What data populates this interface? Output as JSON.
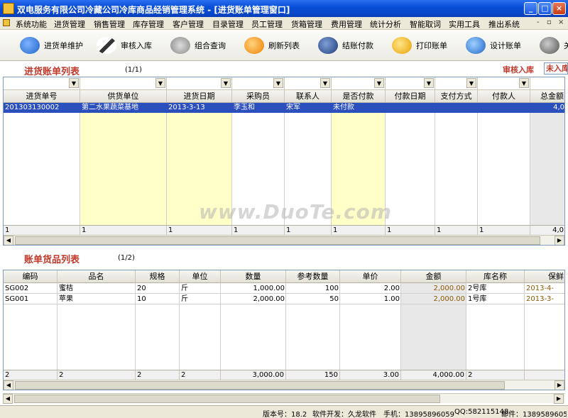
{
  "window": {
    "title": "双电服务有限公司冷藏公司冷库商品经销管理系统 - [进货账单管理窗口]",
    "controls": [
      "_",
      "□",
      "×"
    ]
  },
  "menu": [
    "系统功能",
    "进货管理",
    "销售管理",
    "库存管理",
    "客户管理",
    "目录管理",
    "员工管理",
    "货箱管理",
    "费用管理",
    "统计分析",
    "智能取词",
    "实用工具",
    "推出系统"
  ],
  "mdi_controls": [
    "-",
    "▫",
    "×"
  ],
  "toolbar": [
    {
      "label": "进货单维护",
      "icon": "database-icon",
      "color": "#1e64c8"
    },
    {
      "label": "审核入库",
      "icon": "check-icon",
      "color": "#333333"
    },
    {
      "label": "组合查询",
      "icon": "search-icon",
      "color": "#888888"
    },
    {
      "label": "刷新列表",
      "icon": "refresh-icon",
      "color": "#f08000"
    },
    {
      "label": "结账付款",
      "icon": "pay-icon",
      "color": "#1e3c78"
    },
    {
      "label": "打印账单",
      "icon": "print-icon",
      "color": "#e8a000"
    },
    {
      "label": "设计账单",
      "icon": "design-icon",
      "color": "#1e64c8"
    },
    {
      "label": "关",
      "icon": "close-icon",
      "color": "#555555"
    }
  ],
  "bills": {
    "title": "进货账单列表",
    "page": "(1/1)",
    "audit_label": "审核入库",
    "audit_value": "未入库",
    "columns": [
      "进货单号",
      "供货单位",
      "进货日期",
      "采购员",
      "联系人",
      "是否付款",
      "付款日期",
      "支付方式",
      "付款人",
      "总金额"
    ],
    "rows": [
      [
        "201303130002",
        "第二水果蔬菜基地",
        "2013-3-13",
        "李玉和",
        "宋军",
        "未付款",
        "",
        "",
        "",
        "4,0"
      ]
    ],
    "summary": [
      "1",
      "1",
      "1",
      "1",
      "1",
      "1",
      "1",
      "1",
      "1",
      "4,0"
    ]
  },
  "items": {
    "title": "账单货品列表",
    "page": "(1/2)",
    "columns": [
      "编码",
      "品名",
      "规格",
      "单位",
      "数量",
      "参考数量",
      "单价",
      "金额",
      "库名称",
      "保鲜"
    ],
    "rows": [
      [
        "SG002",
        "蜜桔",
        "20",
        "斤",
        "1,000.00",
        "100",
        "2.00",
        "2,000.00",
        "2号库",
        "2013-4-"
      ],
      [
        "SG001",
        "苹果",
        "10",
        "斤",
        "2,000.00",
        "50",
        "1.00",
        "2,000.00",
        "1号库",
        "2013-3-"
      ]
    ],
    "summary": [
      "2",
      "2",
      "2",
      "2",
      "3,000.00",
      "150",
      "3.00",
      "4,000.00",
      "2",
      ""
    ]
  },
  "status": {
    "version": "版本号：18.2",
    "developer": "软件开发：久龙软件",
    "phone": "手机：13895896059",
    "qq": "QQ:582115148",
    "email": "邮件：13895896059@1"
  },
  "watermark": "www.DuoTe.com"
}
